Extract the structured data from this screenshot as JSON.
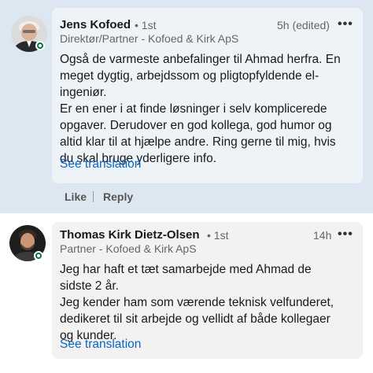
{
  "comments": [
    {
      "author": "Jens Kofoed",
      "degree": "• 1st",
      "headline": "Direktør/Partner - Kofoed & Kirk ApS",
      "time": "5h (edited)",
      "menu": "•••",
      "lines": [
        "Også de varmeste anbefalinger til Ahmad herfra. En",
        "meget dygtig, arbejdssom og pligtopfyldende el-",
        "ingeniør.",
        "Er en ener i at finde løsninger i selv komplicerede",
        "opgaver. Derudover en god kollega, god humor og",
        "altid klar til at hjælpe andre. Ring gerne til mig, hvis",
        "du skal bruge yderligere info."
      ],
      "see_translation": "See translation",
      "actions": {
        "like": "Like",
        "reply": "Reply"
      }
    },
    {
      "author": "Thomas Kirk Dietz-Olsen",
      "degree": "• 1st",
      "headline": "Partner - Kofoed & Kirk ApS",
      "time": "14h",
      "menu": "•••",
      "lines": [
        "Jeg har haft et tæt samarbejde med Ahmad de",
        "sidste 2 år.",
        "Jeg kender ham som værende teknisk velfunderet,",
        "dedikeret til sit arbejde og vellidt af både kollegaer",
        "og kunder."
      ],
      "see_translation": "See translation"
    }
  ],
  "colors": {
    "highlight_bg": "#dde7f1",
    "link": "#0a66c2",
    "presence": "#057642"
  }
}
